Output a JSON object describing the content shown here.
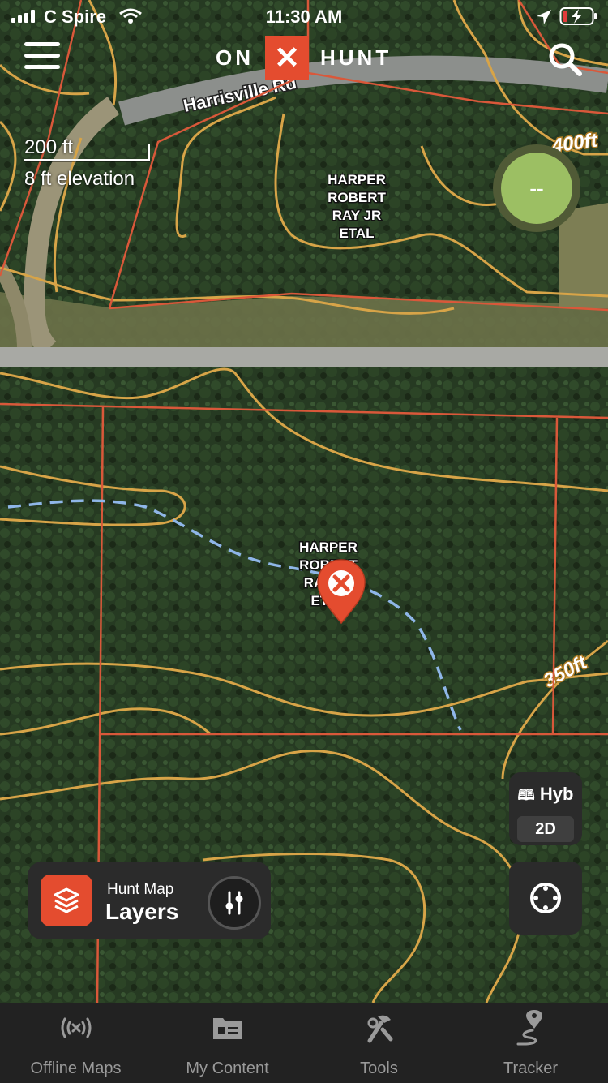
{
  "status_bar": {
    "carrier": "C Spire",
    "time": "11:30 AM"
  },
  "header": {
    "logo_left": "ON",
    "logo_mark": "✕",
    "logo_right": "HUNT"
  },
  "map": {
    "road_label": "Harrisville Rd",
    "scale_distance": "200 ft",
    "scale_elevation": "8 ft elevation",
    "parcel_labels": [
      {
        "lines": [
          "HARPER",
          "ROBERT",
          "RAY JR",
          "ETAL"
        ]
      },
      {
        "lines": [
          "HARPER",
          "ROBERT",
          "RAY JR",
          "ETAL"
        ]
      }
    ],
    "contour_labels": [
      "400ft",
      "350ft"
    ],
    "colors": {
      "parcel_line": "#d9583a",
      "contour_line": "#d7a448",
      "stream": "#8fb6e8",
      "marker": "#e44c2f"
    }
  },
  "gps_reading": "--",
  "map_mode": {
    "style": "Hyb",
    "view": "2D"
  },
  "layers_button": {
    "subtitle": "Hunt Map",
    "title": "Layers"
  },
  "tabs": [
    {
      "label": "Offline Maps",
      "icon": "offline-signal-icon"
    },
    {
      "label": "My Content",
      "icon": "folder-icon"
    },
    {
      "label": "Tools",
      "icon": "tools-icon"
    },
    {
      "label": "Tracker",
      "icon": "tracker-icon"
    }
  ]
}
